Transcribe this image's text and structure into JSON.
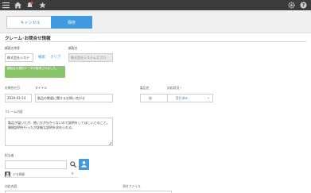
{
  "topbar": {
    "icons_left": [
      "menu-icon",
      "home-icon",
      "notification-bell-icon",
      "star-icon"
    ],
    "icons_right": [
      "gear-icon",
      "help-icon"
    ]
  },
  "toolbar": {
    "cancel_label": "キャンセル",
    "save_label": "保存"
  },
  "form": {
    "section_title": "クレーム･お問合せ情報",
    "customer_name": {
      "label": "顧客名称等",
      "value": "株式会社システ",
      "search_link": "検索",
      "clear_link": "クリア"
    },
    "customer_display": {
      "label": "顧客名",
      "value": "株式会社システムズプロ"
    },
    "success_message": "顧客名の選択データが取得されました。",
    "inquiry_date": {
      "label": "お問合せ日",
      "value": "2020-03-14"
    },
    "title_field": {
      "label": "タイトル",
      "value": "製品の数量に関するお問い合わせ"
    },
    "category": {
      "label": "製品名",
      "value": "箱"
    },
    "status": {
      "label": "対応状況",
      "required_mark": "*",
      "value": "受付済み"
    },
    "claim_content": {
      "label": "クレーム内容",
      "value": "製品が届いたが、使い方が分からないので説明をしてほしいとのこと。開梱説明を行ったが詳細な説明を求められる。"
    },
    "assignee": {
      "label": "担当者",
      "value": "",
      "selected_name": "デモ四郎",
      "remove_symbol": "×"
    },
    "response_content": {
      "label": "対応内容"
    },
    "attachments": {
      "label": "添付ファイル"
    }
  },
  "colors": {
    "accent": "#3f9ae0",
    "link": "#3f8fd2",
    "success": "#8ac56b",
    "topbar": "#3c3c3c",
    "notification": "#e05050"
  }
}
